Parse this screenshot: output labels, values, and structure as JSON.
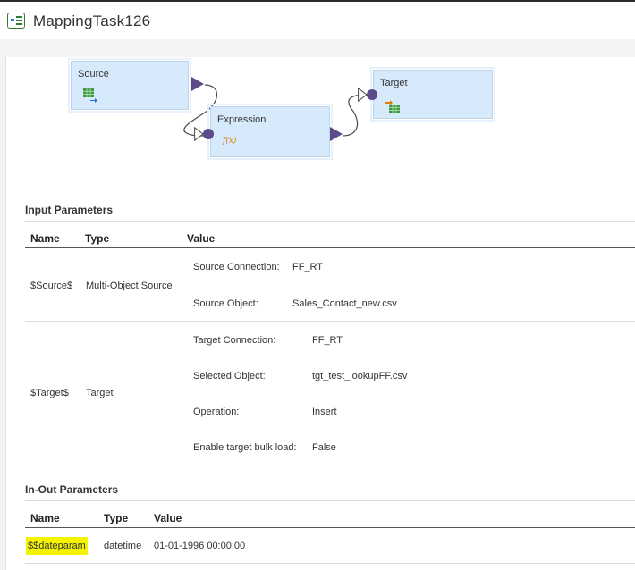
{
  "app": {
    "title": "MappingTask126",
    "icon": "mapping-task-icon"
  },
  "diagram": {
    "source": {
      "label": "Source",
      "icon": "source-table-icon"
    },
    "expression": {
      "label": "Expression",
      "icon": "function-icon",
      "icon_text": "f(x)"
    },
    "target": {
      "label": "Target",
      "icon": "target-table-icon"
    },
    "colors": {
      "node_fill": "#d6eafb",
      "port": "#5c4b8a"
    }
  },
  "input_parameters": {
    "section_title": "Input Parameters",
    "headers": {
      "name": "Name",
      "type": "Type",
      "value": "Value"
    },
    "rows": [
      {
        "name": "$Source$",
        "type": "Multi-Object Source",
        "values": [
          {
            "key": "Source Connection:",
            "val": "FF_RT"
          },
          {
            "key": "Source Object:",
            "val": "Sales_Contact_new.csv"
          }
        ]
      },
      {
        "name": "$Target$",
        "type": "Target",
        "values": [
          {
            "key": "Target Connection:",
            "val": "FF_RT"
          },
          {
            "key": "Selected Object:",
            "val": "tgt_test_lookupFF.csv"
          },
          {
            "key": "Operation:",
            "val": "Insert"
          },
          {
            "key": "Enable target bulk load:",
            "val": "False"
          }
        ]
      }
    ]
  },
  "inout_parameters": {
    "section_title": "In-Out Parameters",
    "headers": {
      "name": "Name",
      "type": "Type",
      "value": "Value"
    },
    "rows": [
      {
        "name": "$$dateparam",
        "type": "datetime",
        "value": "01-01-1996 00:00:00",
        "highlight_color": "#f4f400"
      }
    ]
  }
}
